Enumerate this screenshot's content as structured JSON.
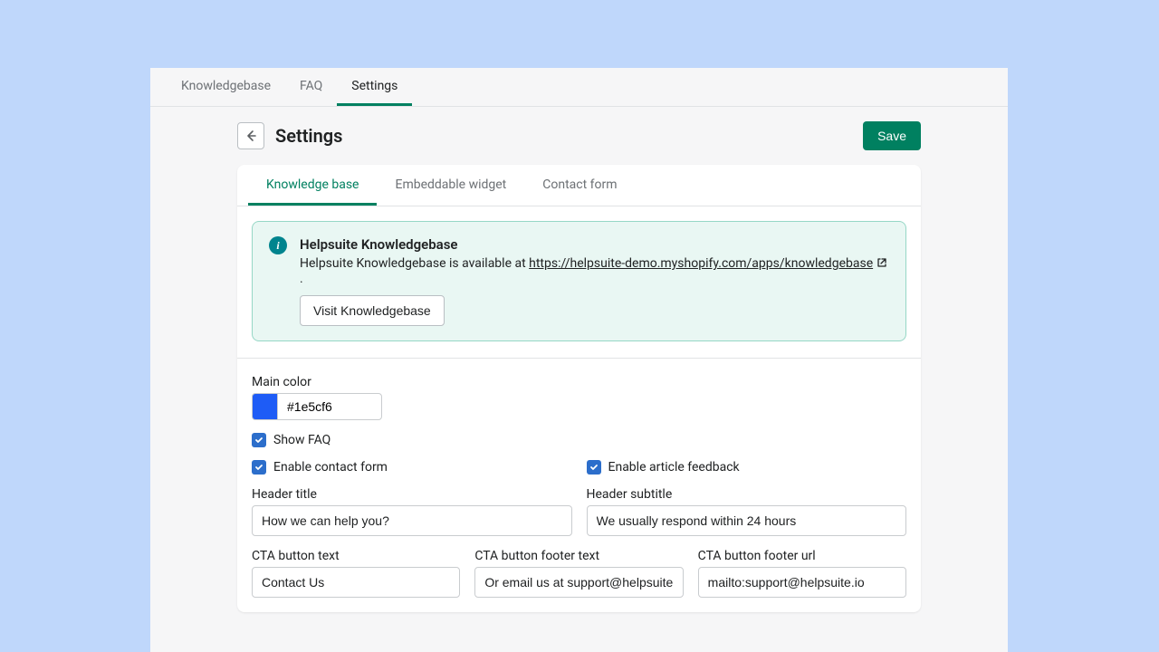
{
  "topTabs": {
    "knowledgebase": "Knowledgebase",
    "faq": "FAQ",
    "settings": "Settings"
  },
  "header": {
    "title": "Settings",
    "save": "Save"
  },
  "subTabs": {
    "kb": "Knowledge base",
    "widget": "Embeddable widget",
    "contact": "Contact form"
  },
  "banner": {
    "title": "Helpsuite Knowledgebase",
    "prefix": "Helpsuite Knowledgebase is available at ",
    "url": "https://helpsuite-demo.myshopify.com/apps/knowledgebase",
    "suffix": " .",
    "visit": "Visit Knowledgebase"
  },
  "fields": {
    "mainColorLabel": "Main color",
    "mainColorValue": "#1e5cf6",
    "showFaq": "Show FAQ",
    "enableContact": "Enable contact form",
    "enableFeedback": "Enable article feedback",
    "headerTitleLabel": "Header title",
    "headerTitleValue": "How we can help you?",
    "headerSubtitleLabel": "Header subtitle",
    "headerSubtitleValue": "We usually respond within 24 hours",
    "ctaTextLabel": "CTA button text",
    "ctaTextValue": "Contact Us",
    "ctaFooterTextLabel": "CTA button footer text",
    "ctaFooterTextValue": "Or email us at support@helpsuite.io",
    "ctaFooterUrlLabel": "CTA button footer url",
    "ctaFooterUrlValue": "mailto:support@helpsuite.io"
  }
}
